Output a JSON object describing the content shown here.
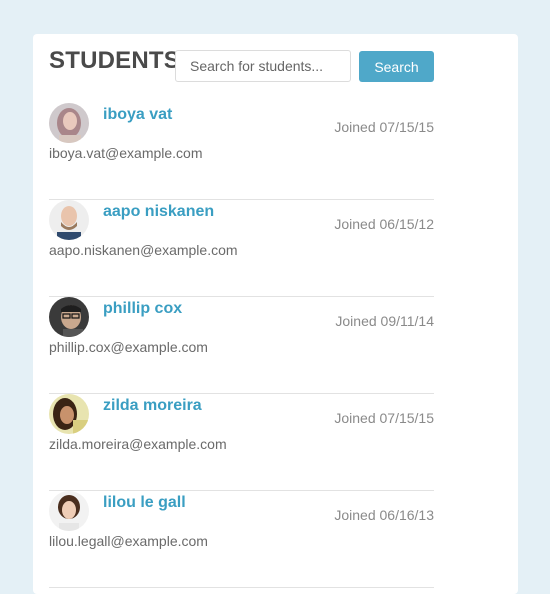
{
  "header": {
    "title": "STUDENTS",
    "search_placeholder": "Search for students...",
    "search_button": "Search"
  },
  "students": [
    {
      "name": "iboya vat",
      "joined": "Joined 07/15/15",
      "email": "iboya.vat@example.com",
      "avatar": "avatar-woman-light-hair"
    },
    {
      "name": "aapo niskanen",
      "joined": "Joined 06/15/12",
      "email": "aapo.niskanen@example.com",
      "avatar": "avatar-man-bald-beard"
    },
    {
      "name": "phillip cox",
      "joined": "Joined 09/11/14",
      "email": "phillip.cox@example.com",
      "avatar": "avatar-man-glasses"
    },
    {
      "name": "zilda moreira",
      "joined": "Joined 07/15/15",
      "email": "zilda.moreira@example.com",
      "avatar": "avatar-woman-dark-hair"
    },
    {
      "name": "lilou le gall",
      "joined": "Joined 06/16/13",
      "email": "lilou.legall@example.com",
      "avatar": "avatar-woman-smiling"
    }
  ],
  "colors": {
    "background": "#e4f0f6",
    "accent": "#4fa8c9",
    "name_link": "#3a9ec2"
  }
}
